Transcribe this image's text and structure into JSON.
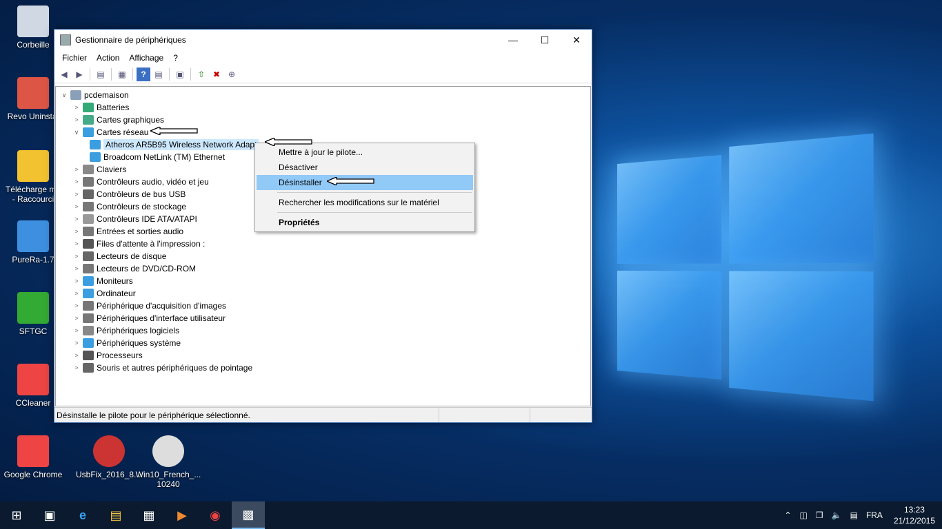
{
  "desktop": {
    "icons": [
      {
        "name": "recycle-bin-icon",
        "label": "Corbeille"
      },
      {
        "name": "revo-uninstaller-icon",
        "label": "Revo Uninstal"
      },
      {
        "name": "telechargements-icon",
        "label": "Télécharge me\n- Raccourci"
      },
      {
        "name": "purera-icon",
        "label": "PureRa-1.7"
      },
      {
        "name": "sftgc-icon",
        "label": "SFTGC"
      },
      {
        "name": "ccleaner-icon",
        "label": "CCleaner"
      },
      {
        "name": "chrome-icon",
        "label": "Google Chrome"
      },
      {
        "name": "usbfix-icon",
        "label": "UsbFix_2016_8...."
      },
      {
        "name": "iso-icon",
        "label": "Win10_French_...\n10240"
      }
    ]
  },
  "window": {
    "title": "Gestionnaire de périphériques",
    "menu": [
      "Fichier",
      "Action",
      "Affichage",
      "?"
    ],
    "tree": {
      "root": "pcdemaison",
      "items": [
        {
          "label": "Batteries",
          "expanded": false
        },
        {
          "label": "Cartes graphiques",
          "expanded": false
        },
        {
          "label": "Cartes réseau",
          "expanded": true
        },
        {
          "label": "Atheros AR5B95 Wireless Network Adapt",
          "child": true,
          "selected": true
        },
        {
          "label": "Broadcom NetLink (TM) Ethernet",
          "child": true
        },
        {
          "label": "Claviers",
          "expanded": false
        },
        {
          "label": "Contrôleurs audio, vidéo et jeu",
          "expanded": false
        },
        {
          "label": "Contrôleurs de bus USB",
          "expanded": false
        },
        {
          "label": "Contrôleurs de stockage",
          "expanded": false
        },
        {
          "label": "Contrôleurs IDE ATA/ATAPI",
          "expanded": false
        },
        {
          "label": "Entrées et sorties audio",
          "expanded": false
        },
        {
          "label": "Files d'attente à l'impression :",
          "expanded": false
        },
        {
          "label": "Lecteurs de disque",
          "expanded": false
        },
        {
          "label": "Lecteurs de DVD/CD-ROM",
          "expanded": false
        },
        {
          "label": "Moniteurs",
          "expanded": false
        },
        {
          "label": "Ordinateur",
          "expanded": false
        },
        {
          "label": "Périphérique d'acquisition d'images",
          "expanded": false
        },
        {
          "label": "Périphériques d'interface utilisateur",
          "expanded": false
        },
        {
          "label": "Périphériques logiciels",
          "expanded": false
        },
        {
          "label": "Périphériques système",
          "expanded": false
        },
        {
          "label": "Processeurs",
          "expanded": false
        },
        {
          "label": "Souris et autres périphériques de pointage",
          "expanded": false
        }
      ]
    },
    "status": "Désinstalle le pilote pour le périphérique sélectionné."
  },
  "context_menu": {
    "items": [
      {
        "label": "Mettre à jour le pilote..."
      },
      {
        "label": "Désactiver"
      },
      {
        "label": "Désinstaller",
        "highlighted": true
      },
      {
        "separator": true
      },
      {
        "label": "Rechercher les modifications sur le matériel"
      },
      {
        "separator": true
      },
      {
        "label": "Propriétés",
        "bold": true
      }
    ]
  },
  "taskbar": {
    "lang": "FRA",
    "time": "13:23",
    "date": "21/12/2015"
  }
}
